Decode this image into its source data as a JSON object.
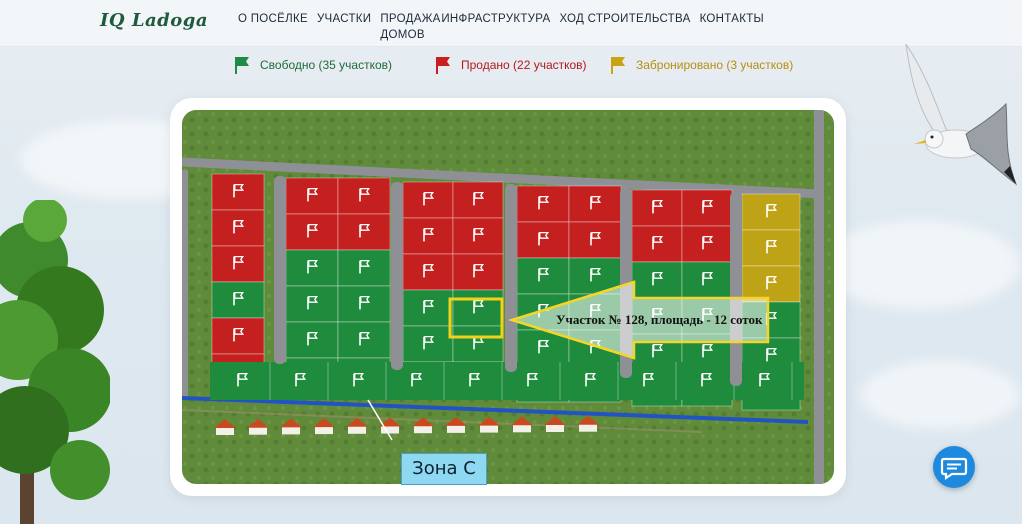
{
  "header": {
    "logo": "IQ Ladoga",
    "nav": [
      "О ПОСЁЛКЕ",
      "УЧАСТКИ",
      "ПРОДАЖА ДОМОВ",
      "ИНФРАСТРУКТУРА",
      "ХОД СТРОИТЕЛЬСТВА",
      "КОНТАКТЫ"
    ]
  },
  "legend": [
    {
      "label": "Свободно (35 участков)",
      "color": "#1e8a44"
    },
    {
      "label": "Продано (22 участков)",
      "color": "#c81e1e"
    },
    {
      "label": "Забронировано (3 участков)",
      "color": "#c9a312"
    }
  ],
  "map": {
    "highlight_label": "Участок № 128, площадь - 12 соток",
    "zone_label": "Зона С",
    "colors": {
      "free": "#1f8b3c",
      "sold": "#c42020",
      "reserved": "#bfa316",
      "grass": "#5e8a3a",
      "road": "#8d8f93"
    }
  },
  "icons": {
    "chat": "chat-icon",
    "flag": "flag-icon"
  }
}
